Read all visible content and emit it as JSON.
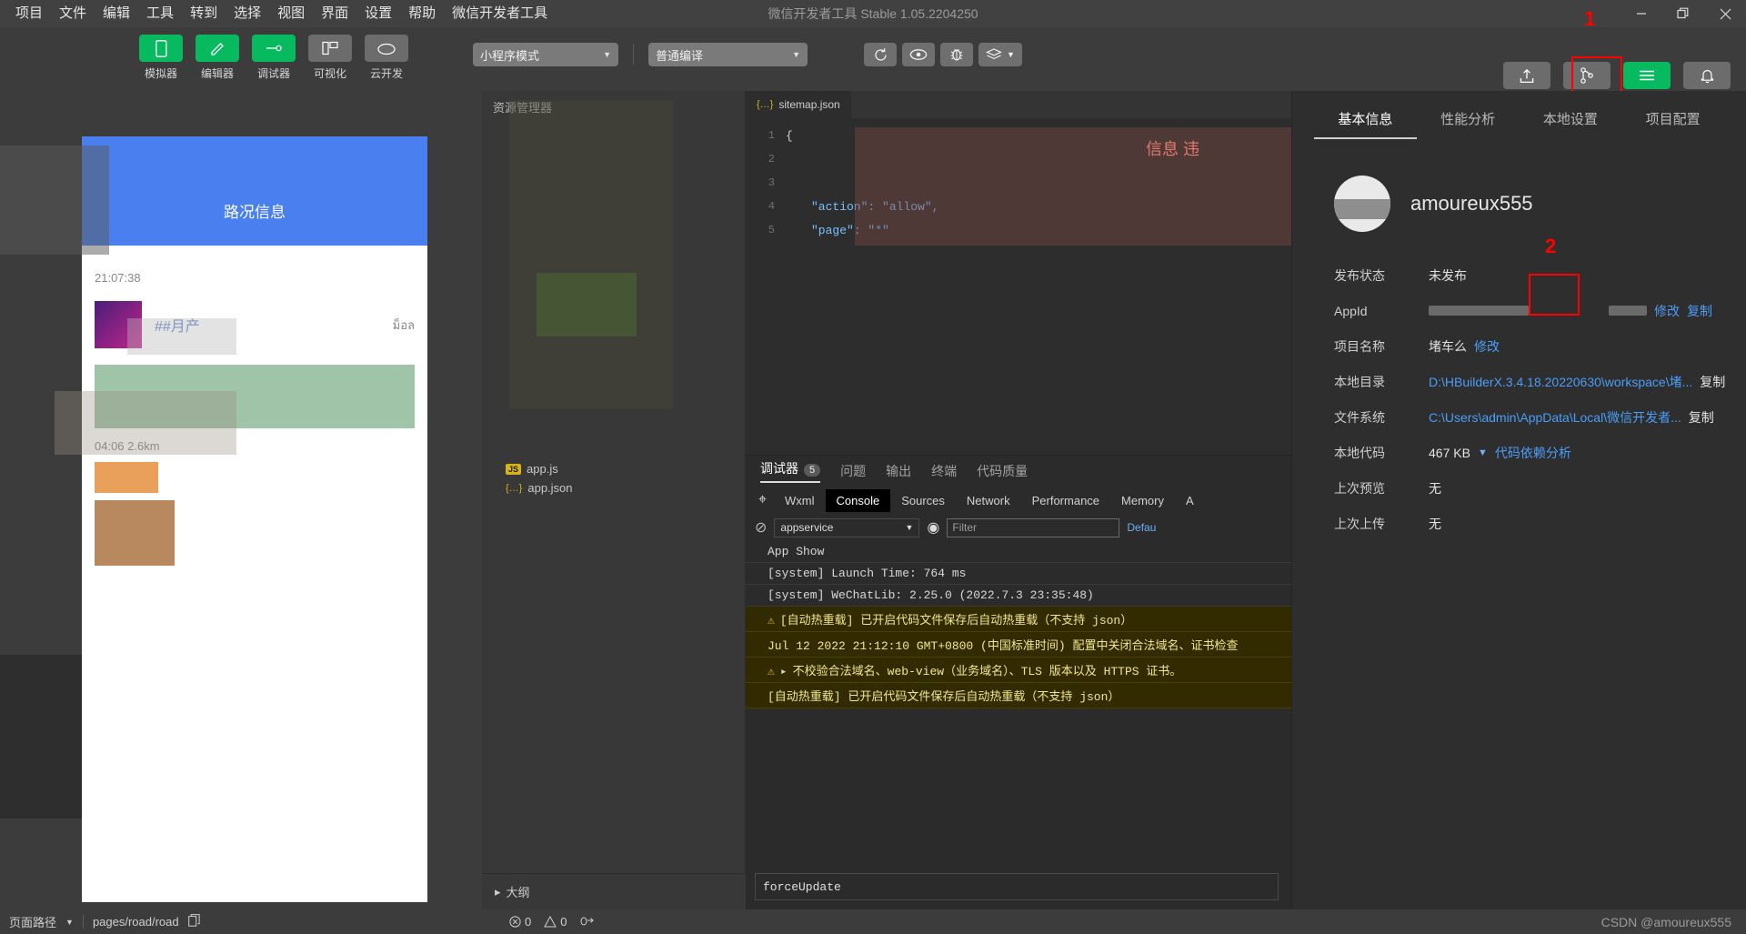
{
  "titlebar": {
    "menus": [
      "项目",
      "文件",
      "编辑",
      "工具",
      "转到",
      "选择",
      "视图",
      "界面",
      "设置",
      "帮助",
      "微信开发者工具"
    ],
    "window_title": "微信开发者工具 Stable 1.05.2204250",
    "minimize": "minimize-icon",
    "restore": "restore-icon",
    "close": "close-icon"
  },
  "toolbar": {
    "buttons": [
      {
        "label": "模拟器",
        "icon": "phone-icon",
        "active": true
      },
      {
        "label": "编辑器",
        "icon": "edit-icon",
        "active": true
      },
      {
        "label": "调试器",
        "icon": "debug-icon",
        "active": true
      },
      {
        "label": "可视化",
        "icon": "visual-icon",
        "active": false
      },
      {
        "label": "云开发",
        "icon": "cloud-icon",
        "active": false
      }
    ],
    "mode_select": "小程序模式",
    "compile_select": "普通编译",
    "icon_buttons": [
      {
        "name": "refresh-icon",
        "glyph": "⟳"
      },
      {
        "name": "preview-eye-icon",
        "glyph": "◉"
      },
      {
        "name": "debug-bug-icon",
        "glyph": "🐞"
      },
      {
        "name": "layers-icon",
        "glyph": "≡"
      }
    ],
    "right_buttons": [
      {
        "label": "上传",
        "icon": "upload-icon"
      },
      {
        "label": "版本管理",
        "icon": "branch-icon"
      },
      {
        "label": "详情",
        "icon": "menu-icon",
        "highlight": true
      },
      {
        "label": "消息",
        "icon": "bell-icon"
      }
    ],
    "annotation_1": "1",
    "annotation_color": "#ff0000"
  },
  "simulator": {
    "page_title": "路况信息",
    "header_color": "#4a7ff0",
    "items": [
      {
        "time": "21:07:38",
        "title": "##月产",
        "note": "ม็อล",
        "distance": "04:06 2.6km"
      }
    ]
  },
  "tree": {
    "header": "资源管理器",
    "items": [
      {
        "label": "app.js",
        "icon": "js-file-icon"
      },
      {
        "label": "app.json",
        "icon": "json-file-icon"
      }
    ],
    "outline_label": "大纲"
  },
  "editor": {
    "tab_name": "sitemap.json",
    "lines": [
      {
        "no": "1",
        "text": "{"
      },
      {
        "no": "2",
        "text": ""
      },
      {
        "no": "3",
        "text": ""
      },
      {
        "no": "4",
        "text": "\"action\": \"allow\","
      },
      {
        "no": "5",
        "text": "\"page\": \"*\""
      }
    ],
    "overlay_text": "信息  违"
  },
  "console": {
    "panel_tabs": [
      {
        "label": "调试器",
        "count": "5",
        "active": true
      },
      {
        "label": "问题",
        "count": "",
        "active": false
      },
      {
        "label": "输出",
        "count": "",
        "active": false
      },
      {
        "label": "终端",
        "count": "",
        "active": false
      },
      {
        "label": "代码质量",
        "count": "",
        "active": false
      }
    ],
    "devtool_tabs": [
      {
        "label": "Wxml",
        "active": false
      },
      {
        "label": "Console",
        "active": true
      },
      {
        "label": "Sources",
        "active": false
      },
      {
        "label": "Network",
        "active": false
      },
      {
        "label": "Performance",
        "active": false
      },
      {
        "label": "Memory",
        "active": false
      },
      {
        "label": "A",
        "active": false
      }
    ],
    "inspect_icon": "inspect-cursor-icon",
    "clear_icon": "clear-console-icon",
    "context": "appservice",
    "eye_icon": "eye-icon",
    "filter_placeholder": "Filter",
    "levels_label": "Defau",
    "logs": [
      {
        "type": "info",
        "text": "App Show"
      },
      {
        "type": "info",
        "text": "[system] Launch Time: 764 ms"
      },
      {
        "type": "info",
        "text": "[system] WeChatLib: 2.25.0 (2022.7.3 23:35:48)"
      },
      {
        "type": "warn",
        "text": "[自动热重载] 已开启代码文件保存后自动热重载（不支持 json）"
      },
      {
        "type": "warn",
        "text": "Jul 12 2022 21:12:10 GMT+0800 (中国标准时间) 配置中关闭合法域名、证书检查"
      },
      {
        "type": "warn",
        "text": "不校验合法域名、web-view（业务域名）、TLS 版本以及 HTTPS 证书。"
      },
      {
        "type": "warn",
        "text": "[自动热重载] 已开启代码文件保存后自动热重载（不支持 json）"
      }
    ],
    "input_value": "forceUpdate"
  },
  "details": {
    "tabs": [
      {
        "label": "基本信息",
        "active": true
      },
      {
        "label": "性能分析",
        "active": false
      },
      {
        "label": "本地设置",
        "active": false
      },
      {
        "label": "项目配置",
        "active": false
      }
    ],
    "username": "amoureux555",
    "annotation_2": "2",
    "rows": [
      {
        "label": "发布状态",
        "value": "未发布",
        "links": []
      },
      {
        "label": "AppId",
        "value": "",
        "redacted": true,
        "links": [
          "修改",
          "复制"
        ],
        "highlight_link": "修改"
      },
      {
        "label": "项目名称",
        "value": "堵车么",
        "links": [
          "修改"
        ]
      },
      {
        "label": "本地目录",
        "value": "D:\\HBuilderX.3.4.18.20220630\\workspace\\堵...",
        "value_is_link": true,
        "links": [
          "复制"
        ]
      },
      {
        "label": "文件系统",
        "value": "C:\\Users\\admin\\AppData\\Local\\微信开发者...",
        "value_is_link": true,
        "links": [
          "复制"
        ]
      },
      {
        "label": "本地代码",
        "value": "467 KB",
        "chevron": true,
        "links": [
          "代码依赖分析"
        ]
      },
      {
        "label": "上次预览",
        "value": "无",
        "links": []
      },
      {
        "label": "上次上传",
        "value": "无",
        "links": []
      }
    ]
  },
  "statusbar": {
    "page_path_label": "页面路径",
    "page_path_value": "pages/road/road",
    "copy_icon": "copy-icon",
    "error_count": "0",
    "warning_count": "0",
    "error_icon": "error-circle-icon",
    "warning_icon": "warning-triangle-icon",
    "debug_icon": "debug-arrow-icon",
    "watermark": "CSDN @amoureux555"
  }
}
